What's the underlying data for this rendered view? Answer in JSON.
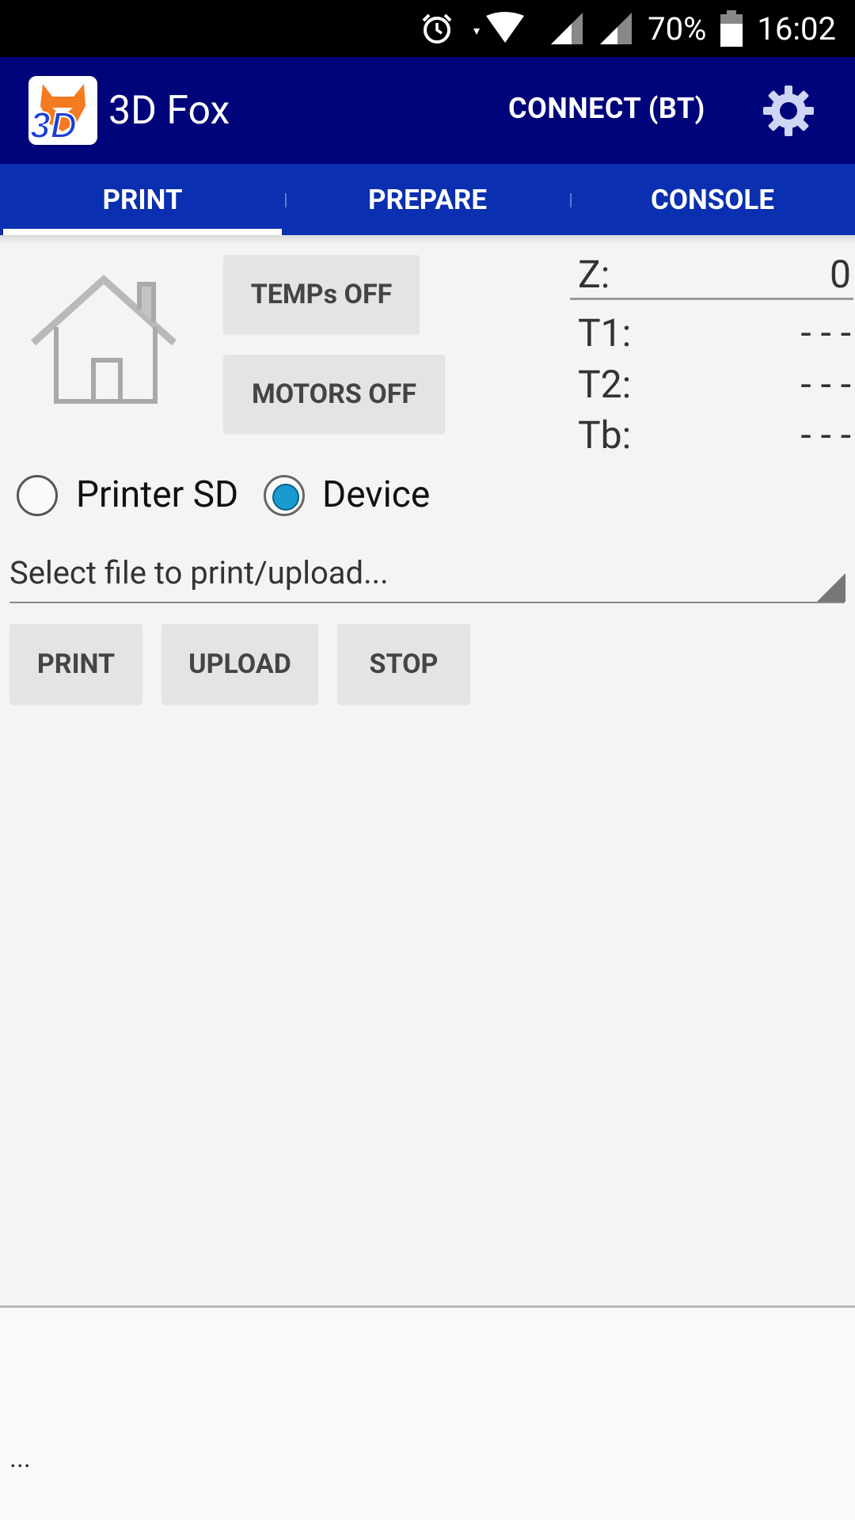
{
  "status_bar": {
    "battery": "70%",
    "time": "16:02",
    "icons": [
      "alarm-icon",
      "wifi-icon",
      "signal-icon",
      "signal-icon-2",
      "battery-icon"
    ]
  },
  "app_bar": {
    "title": "3D Fox",
    "connect_label": "CONNECT (BT)"
  },
  "tabs": [
    {
      "label": "PRINT",
      "active": true
    },
    {
      "label": "PREPARE",
      "active": false
    },
    {
      "label": "CONSOLE",
      "active": false
    }
  ],
  "controls": {
    "temps_off": "TEMPs OFF",
    "motors_off": "MOTORS OFF"
  },
  "readouts": {
    "z_label": "Z:",
    "z_value": "0",
    "t1_label": "T1:",
    "t1_value": "- - -",
    "t2_label": "T2:",
    "t2_value": "- - -",
    "tb_label": "Tb:",
    "tb_value": "- - -"
  },
  "source": {
    "options": [
      "Printer SD",
      "Device"
    ],
    "selected": "Device"
  },
  "file_select": {
    "placeholder": "Select file to print/upload..."
  },
  "actions": {
    "print": "PRINT",
    "upload": "UPLOAD",
    "stop": "STOP"
  },
  "log": {
    "text": "..."
  },
  "colors": {
    "appbar": "#00047a",
    "tabs": "#0a2fb0",
    "radio_accent": "#1a9bd0"
  }
}
